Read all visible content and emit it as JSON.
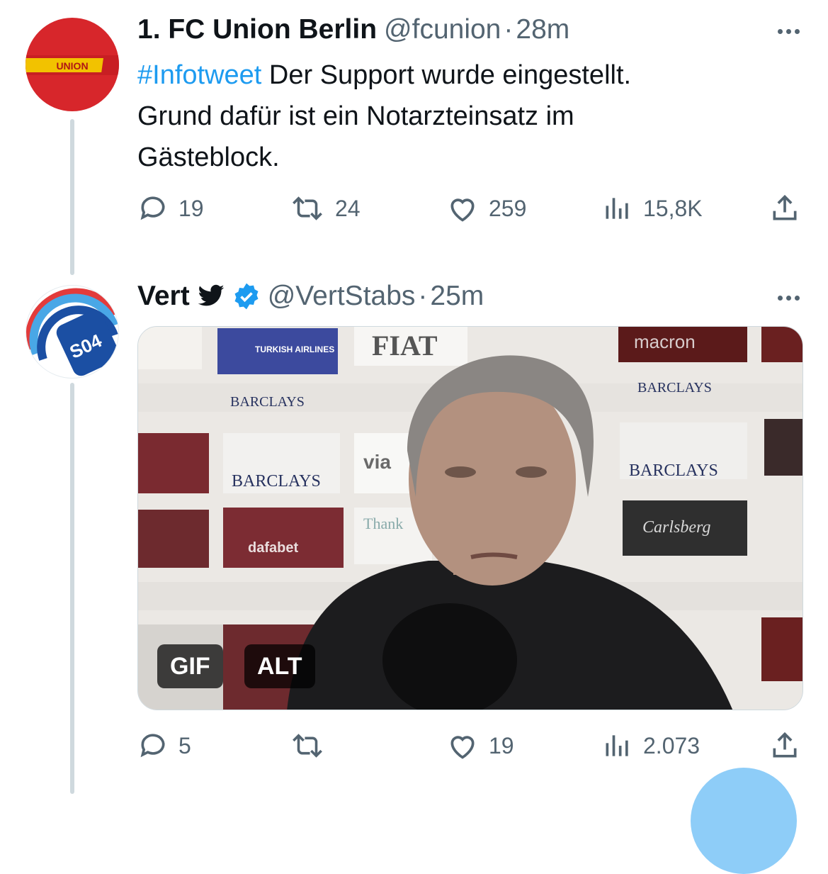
{
  "tweets": [
    {
      "name": "1. FC Union Berlin",
      "handle": "@fcunion",
      "dot": "·",
      "time": "28m",
      "hashtag": "#Infotweet",
      "text_line1": " Der Support wurde eingestellt.",
      "text_line2": "Grund dafür ist ein Notarzteinsatz im",
      "text_line3": "Gästeblock.",
      "avatar_text": "UNION",
      "replies": "19",
      "retweets": "24",
      "likes": "259",
      "views": "15,8K"
    },
    {
      "name": "Vert",
      "handle": "@VertStabs",
      "dot": "·",
      "time": "25m",
      "avatar_text": "S04",
      "media_badges": {
        "gif": "GIF",
        "alt": "ALT"
      },
      "media_signs": [
        "BARCLAYS",
        "BARCLAYS",
        "BARCLAYS",
        "BARCLAYS",
        "FIAT",
        "TURKISH AIRLINES",
        "dafabet",
        "macron",
        "Carlsberg",
        "via",
        "Thank"
      ],
      "replies": "5",
      "retweets": "",
      "likes": "19",
      "views": "2.073"
    }
  ],
  "icons": [
    "reply-icon",
    "retweet-icon",
    "like-icon",
    "views-icon",
    "share-icon",
    "verified-icon",
    "bird-icon",
    "more-icon"
  ],
  "colors": {
    "accent": "#1d9bf0",
    "muted": "#536471",
    "union_red": "#d7262b",
    "schalke_blue": "#1b4fa3"
  }
}
